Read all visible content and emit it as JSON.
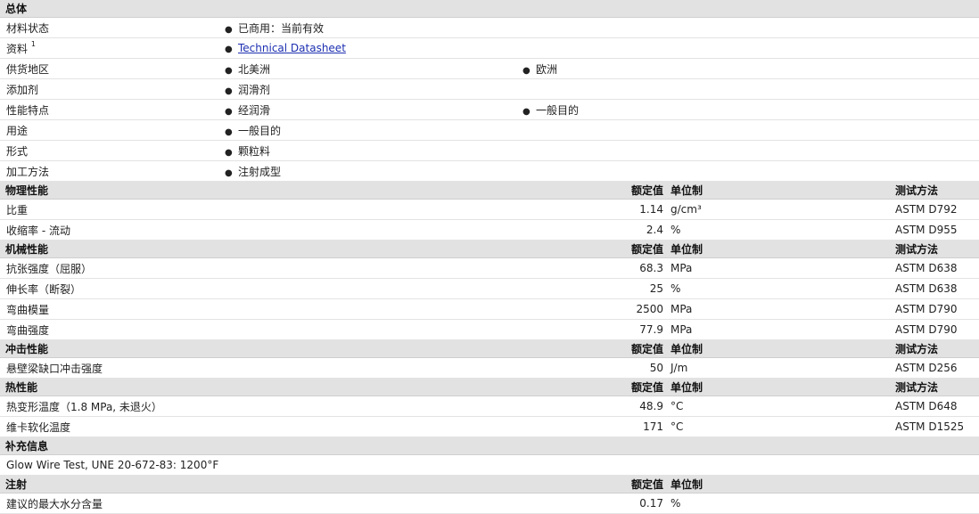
{
  "general": {
    "title": "总体",
    "rows": [
      {
        "name": "材料状态",
        "col1": "已商用：当前有效",
        "col2": ""
      },
      {
        "name": "资料",
        "sup": "1",
        "col1": "Technical Datasheet",
        "col2": "",
        "link": true
      },
      {
        "name": "供货地区",
        "col1": "北美洲",
        "col2": "欧洲"
      },
      {
        "name": "添加剂",
        "col1": "润滑剂",
        "col2": ""
      },
      {
        "name": "性能特点",
        "col1": "经润滑",
        "col2": "一般目的"
      },
      {
        "name": "用途",
        "col1": "一般目的",
        "col2": ""
      },
      {
        "name": "形式",
        "col1": "颗粒料",
        "col2": ""
      },
      {
        "name": "加工方法",
        "col1": "注射成型",
        "col2": ""
      }
    ]
  },
  "headers": {
    "rated": "额定值",
    "unit": "单位制",
    "method": "测试方法"
  },
  "physical": {
    "title": "物理性能",
    "rows": [
      {
        "name": "比重",
        "value": "1.14",
        "unit": "g/cm³",
        "method": "ASTM D792"
      },
      {
        "name": "收缩率  - 流动",
        "value": "2.4",
        "unit": "%",
        "method": "ASTM D955"
      }
    ]
  },
  "mechanical": {
    "title": "机械性能",
    "rows": [
      {
        "name": "抗张强度（屈服）",
        "value": "68.3",
        "unit": "MPa",
        "method": "ASTM D638"
      },
      {
        "name": "伸长率（断裂）",
        "value": "25",
        "unit": "%",
        "method": "ASTM D638"
      },
      {
        "name": "弯曲模量",
        "value": "2500",
        "unit": "MPa",
        "method": "ASTM D790"
      },
      {
        "name": "弯曲强度",
        "value": "77.9",
        "unit": "MPa",
        "method": "ASTM D790"
      }
    ]
  },
  "impact": {
    "title": "冲击性能",
    "rows": [
      {
        "name": "悬壁梁缺口冲击强度",
        "value": "50",
        "unit": "J/m",
        "method": "ASTM D256"
      }
    ]
  },
  "thermal": {
    "title": "热性能",
    "rows": [
      {
        "name": "热变形温度（1.8 MPa, 未退火）",
        "value": "48.9",
        "unit": "°C",
        "method": "ASTM D648"
      },
      {
        "name": "维卡软化温度",
        "value": "171",
        "unit": "°C",
        "method": "ASTM D1525"
      }
    ]
  },
  "supplemental": {
    "title": "补充信息",
    "note": "Glow Wire Test, UNE 20-672-83: 1200°F"
  },
  "injection": {
    "title": "注射",
    "rows": [
      {
        "name": "建议的最大水分含量",
        "value": "0.17",
        "unit": "%",
        "method": ""
      }
    ]
  }
}
